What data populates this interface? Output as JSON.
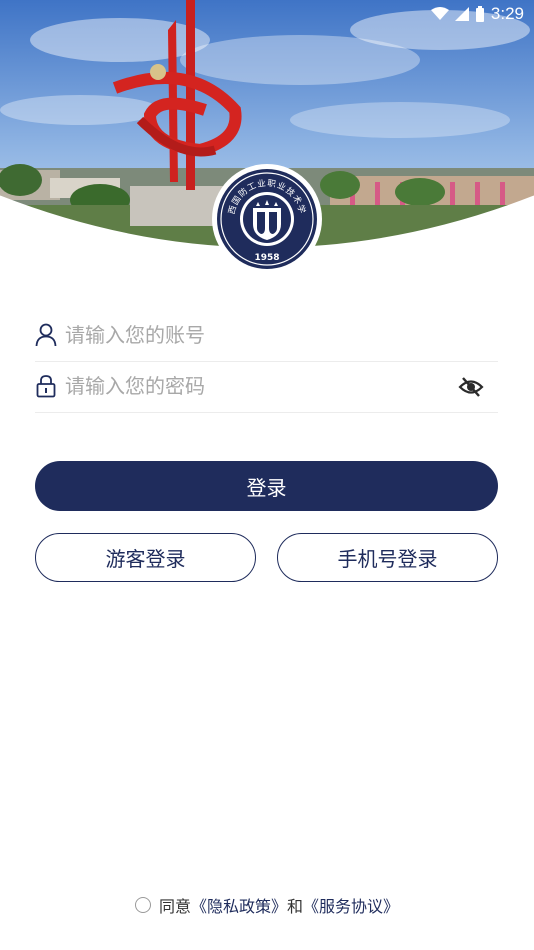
{
  "status_bar": {
    "time": "3:29"
  },
  "header": {
    "emblem_year": "1958",
    "emblem_arc_text": "陕西国防工业职业技术学院"
  },
  "login_form": {
    "username_placeholder": "请输入您的账号",
    "password_placeholder": "请输入您的密码",
    "login_button": "登录",
    "guest_login_button": "游客登录",
    "phone_login_button": "手机号登录"
  },
  "agreement": {
    "prefix": "同意",
    "privacy_link": "《隐私政策》",
    "and": "和",
    "service_link": "《服务协议》"
  },
  "colors": {
    "primary": "#1f2c5c",
    "placeholder": "#a8a8a8"
  }
}
